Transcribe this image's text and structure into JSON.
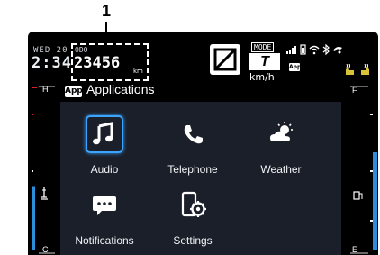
{
  "annotation": {
    "callout_number": "1"
  },
  "status_bar": {
    "date": "WED 20",
    "time": "2:34",
    "odo_label": "ODO",
    "odometer": "23456",
    "odo_unit": "km",
    "mode_label": "MODE",
    "mode_letter": "T",
    "speed_unit": "km/h",
    "app_chip": "App"
  },
  "header": {
    "app_chip": "App",
    "title": "Applications"
  },
  "gauges": {
    "temp_high": "H",
    "temp_low": "C",
    "fuel_full": "F",
    "fuel_empty": "E",
    "temp_level": 0.47,
    "fuel_level": 0.72,
    "colors": {
      "temp_bar": "#2c8ed9",
      "fuel_bar": "#2c8ed9",
      "temp_mark": "#d8202a",
      "fuel_top_mark": "#d8202a"
    }
  },
  "apps": [
    {
      "label": "Audio",
      "icon": "music-note-icon",
      "selected": true
    },
    {
      "label": "Telephone",
      "icon": "phone-icon",
      "selected": false
    },
    {
      "label": "Weather",
      "icon": "weather-icon",
      "selected": false
    },
    {
      "label": "Notifications",
      "icon": "notification-bubble-icon",
      "selected": false
    },
    {
      "label": "Settings",
      "icon": "settings-gear-icon",
      "selected": false
    }
  ]
}
